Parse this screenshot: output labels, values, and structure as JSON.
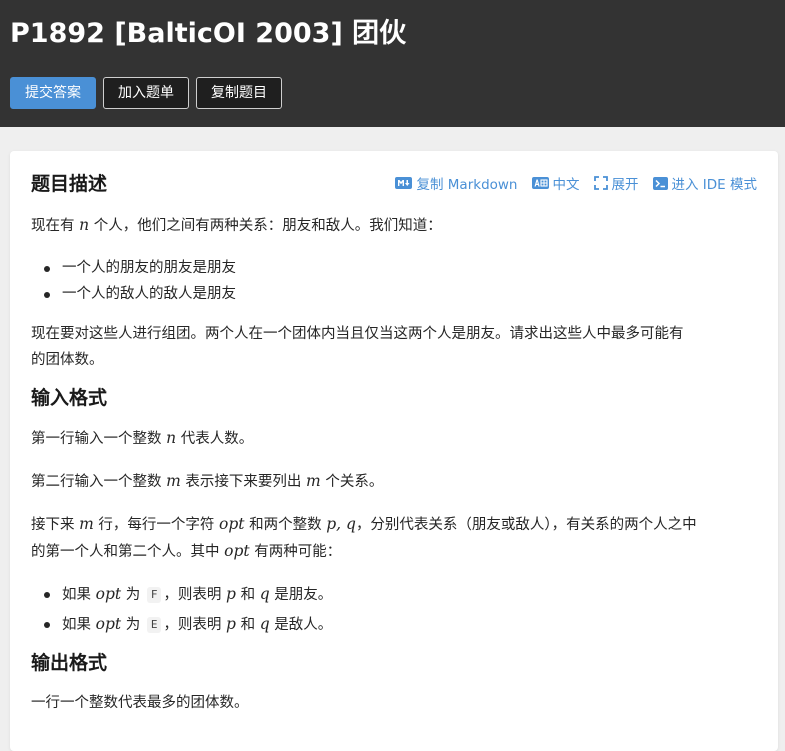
{
  "header": {
    "title": "P1892 [BalticOI 2003] 团伙",
    "buttons": {
      "submit": "提交答案",
      "add_to_list": "加入题单",
      "copy_problem": "复制题目"
    }
  },
  "toolbar": {
    "copy_markdown": "复制 Markdown",
    "language": "中文",
    "expand": "展开",
    "ide_mode": "进入 IDE 模式"
  },
  "description": {
    "heading": "题目描述",
    "p1_before": "现在有 ",
    "p1_var": "n",
    "p1_after": " 个人，他们之间有两种关系：朋友和敌人。我们知道：",
    "bullet1": "一个人的朋友的朋友是朋友",
    "bullet2": "一个人的敌人的敌人是朋友",
    "p2_line1": "现在要对这些人进行组团。两个人在一个团体内当且仅当这两个人是朋友。请求出这些人中最多可能有",
    "p2_line2": "的团体数。"
  },
  "input_format": {
    "heading": "输入格式",
    "p1_before": "第一行输入一个整数 ",
    "p1_var": "n",
    "p1_after": " 代表人数。",
    "p2_before": "第二行输入一个整数 ",
    "p2_var1": "m",
    "p2_mid": " 表示接下来要列出 ",
    "p2_var2": "m",
    "p2_after": " 个关系。",
    "p3_before": "接下来 ",
    "p3_var1": "m",
    "p3_mid1": " 行，每行一个字符 ",
    "p3_var2": "opt",
    "p3_mid2": " 和两个整数 ",
    "p3_var3": "p, q",
    "p3_after": "，分别代表关系（朋友或敌人），有关系的两个人之中",
    "p3_line2_before": "的第一个人和第二个人。其中 ",
    "p3_line2_var": "opt",
    "p3_line2_after": " 有两种可能：",
    "b1_before": "如果 ",
    "b1_var": "opt",
    "b1_mid": " 为 ",
    "b1_code": "F",
    "b1_mid2": "，则表明 ",
    "b1_var_p": "p",
    "b1_and": " 和 ",
    "b1_var_q": "q",
    "b1_after": " 是朋友。",
    "b2_before": "如果 ",
    "b2_var": "opt",
    "b2_mid": " 为 ",
    "b2_code": "E",
    "b2_mid2": "，则表明 ",
    "b2_var_p": "p",
    "b2_and": " 和 ",
    "b2_var_q": "q",
    "b2_after": " 是敌人。"
  },
  "output_format": {
    "heading": "输出格式",
    "p1": "一行一个整数代表最多的团体数。"
  },
  "icons": {
    "markdown": "markdown-icon",
    "language": "translate-icon",
    "expand": "expand-icon",
    "ide": "terminal-icon"
  },
  "colors": {
    "header_bg": "#333333",
    "accent": "#4a90d6",
    "page_bg": "#efefef"
  }
}
